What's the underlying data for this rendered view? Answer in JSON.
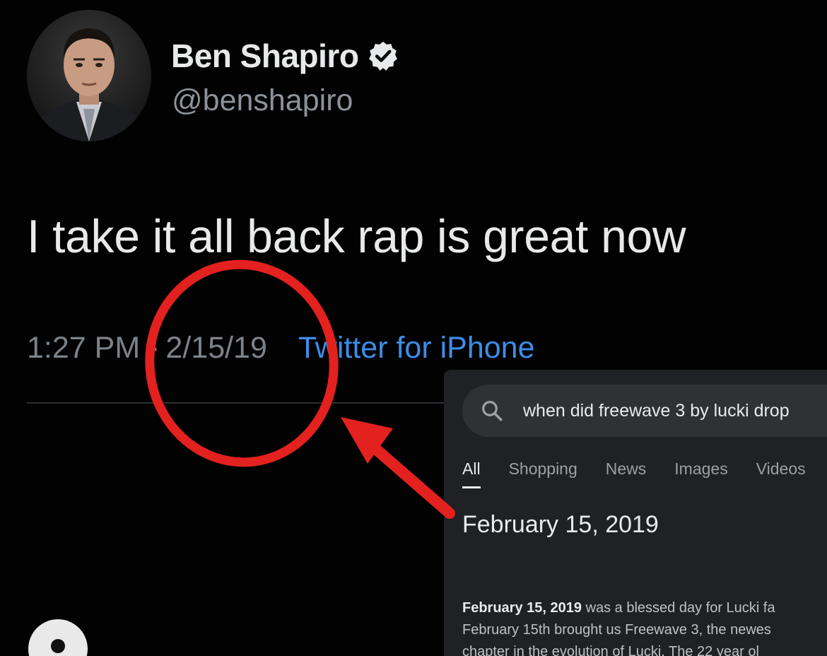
{
  "tweet": {
    "display_name": "Ben Shapiro",
    "handle": "@benshapiro",
    "text": "I take it all back rap is great now",
    "time": "1:27 PM",
    "separator": "·",
    "date": "2/15/19",
    "client": "Twitter for iPhone",
    "verified_icon": "verified-badge-icon",
    "avatar_icon": "profile-photo"
  },
  "search": {
    "query": "when did freewave 3 by lucki drop",
    "search_icon": "magnifier-icon",
    "tabs": [
      {
        "label": "All",
        "active": true
      },
      {
        "label": "Shopping",
        "active": false
      },
      {
        "label": "News",
        "active": false
      },
      {
        "label": "Images",
        "active": false
      },
      {
        "label": "Videos",
        "active": false
      }
    ],
    "answer": "February 15, 2019",
    "snippet": {
      "bold": "February 15, 2019",
      "line1_rest": "was a blessed day for Lucki fa",
      "line2": "February 15th brought us Freewave 3, the newes",
      "line3": "chapter in the evolution of Lucki. The 22 year ol"
    }
  },
  "annotation": {
    "color": "#e3211e",
    "shapes": [
      "circle",
      "arrow"
    ]
  },
  "colors": {
    "background": "#020202",
    "tweet_text": "#e7e9ea",
    "secondary_text": "#7c8389",
    "link": "#3d8de8",
    "panel_bg": "#202124"
  }
}
